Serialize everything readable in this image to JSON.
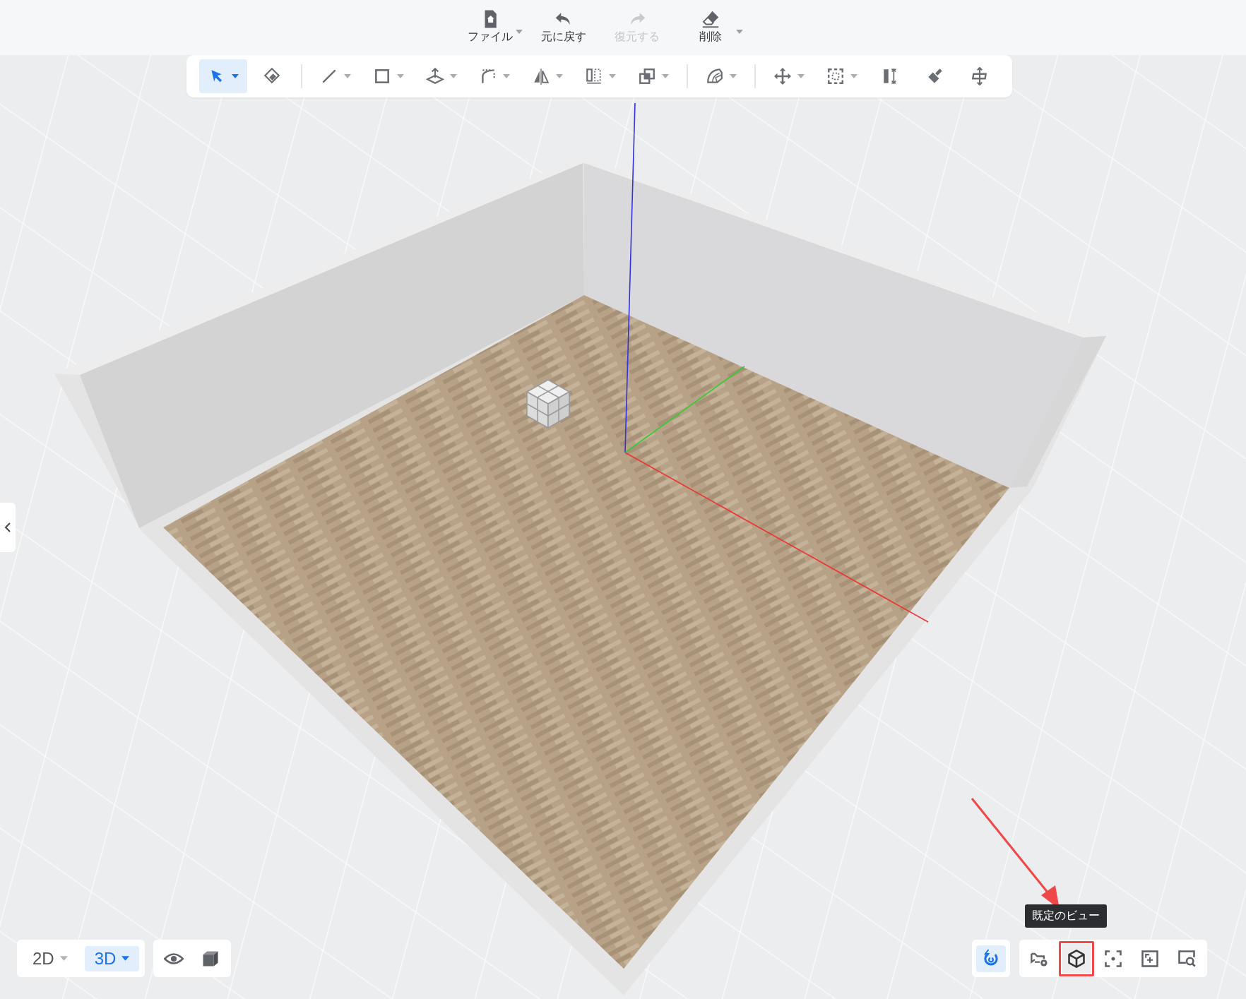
{
  "menu": [
    {
      "label": "ファイル",
      "has_menu": true,
      "disabled": false
    },
    {
      "label": "元に戻す",
      "has_menu": false,
      "disabled": false
    },
    {
      "label": "復元する",
      "has_menu": false,
      "disabled": true
    },
    {
      "label": "削除",
      "has_menu": true,
      "disabled": false
    }
  ],
  "toolbar": {
    "groups": [
      {
        "tools": [
          {
            "selected": true,
            "has_menu": true
          },
          {
            "selected": false,
            "has_menu": false
          }
        ]
      },
      {
        "tools": [
          {
            "selected": false,
            "has_menu": true
          },
          {
            "selected": false,
            "has_menu": true
          },
          {
            "selected": false,
            "has_menu": true
          },
          {
            "selected": false,
            "has_menu": true
          },
          {
            "selected": false,
            "has_menu": true
          },
          {
            "selected": false,
            "has_menu": true
          },
          {
            "selected": false,
            "has_menu": true
          }
        ]
      },
      {
        "tools": [
          {
            "selected": false,
            "has_menu": true
          }
        ]
      },
      {
        "tools": [
          {
            "selected": false,
            "has_menu": true
          },
          {
            "selected": false,
            "has_menu": true
          },
          {
            "selected": false,
            "has_menu": false
          },
          {
            "selected": false,
            "has_menu": false
          },
          {
            "selected": false,
            "has_menu": false
          }
        ]
      }
    ]
  },
  "view_modes": [
    {
      "label": "2D",
      "selected": false
    },
    {
      "label": "3D",
      "selected": true
    }
  ],
  "snap": {
    "on": true
  },
  "view_tools": [
    {
      "highlighted": false
    },
    {
      "highlighted": true
    },
    {
      "highlighted": false
    },
    {
      "highlighted": false
    },
    {
      "highlighted": false
    }
  ],
  "tooltip": {
    "text": "既定のビュー"
  }
}
